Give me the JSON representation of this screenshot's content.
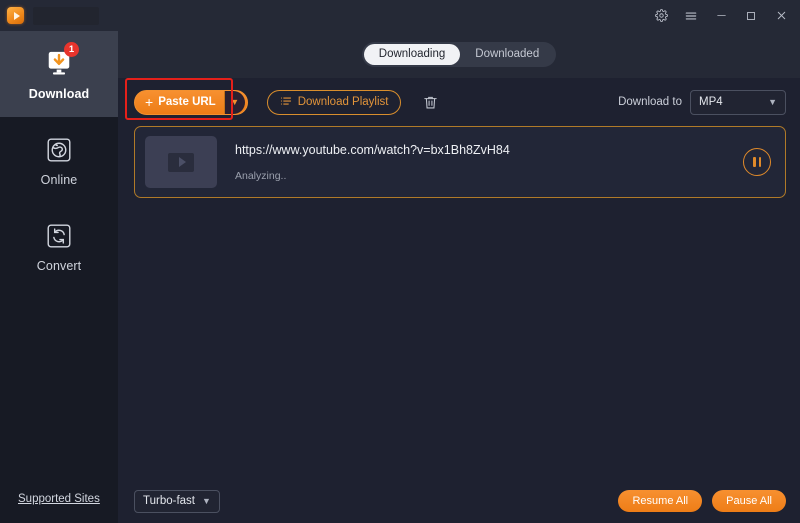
{
  "titlebar": {
    "logo_icon": "app-logo-play-icon",
    "title": "",
    "controls": [
      {
        "name": "settings-gear-icon",
        "glyph": "gear"
      },
      {
        "name": "menu-hamburger-icon",
        "glyph": "menu"
      },
      {
        "name": "minimize-icon",
        "glyph": "minimize"
      },
      {
        "name": "maximize-icon",
        "glyph": "maximize"
      },
      {
        "name": "close-icon",
        "glyph": "close"
      }
    ]
  },
  "sidebar": {
    "items": [
      {
        "label": "Download",
        "icon": "download-monitor-icon",
        "active": true,
        "badge": "1"
      },
      {
        "label": "Online",
        "icon": "globe-icon",
        "active": false,
        "badge": ""
      },
      {
        "label": "Convert",
        "icon": "convert-refresh-icon",
        "active": false,
        "badge": ""
      }
    ],
    "supported_sites_label": "Supported Sites"
  },
  "tabs": {
    "downloading": "Downloading",
    "downloaded": "Downloaded"
  },
  "toolbar": {
    "paste_url_label": "Paste URL",
    "paste_url_plus": "+",
    "paste_url_caret": "▼",
    "download_playlist_label": "Download Playlist",
    "trash_icon": "delete-trash-icon",
    "download_to_label": "Download to",
    "format_value": "MP4",
    "format_caret": "▼",
    "highlight_color": "#e5201a",
    "accent_color": "#ee7d17"
  },
  "downloads": [
    {
      "url": "https://www.youtube.com/watch?v=bx1Bh8ZvH84",
      "status": "Analyzing..",
      "thumb_icon": "video-placeholder-icon",
      "action_icon": "pause-icon"
    }
  ],
  "bottombar": {
    "speed_value": "Turbo-fast",
    "speed_caret": "▼",
    "resume_all_label": "Resume All",
    "pause_all_label": "Pause All"
  }
}
